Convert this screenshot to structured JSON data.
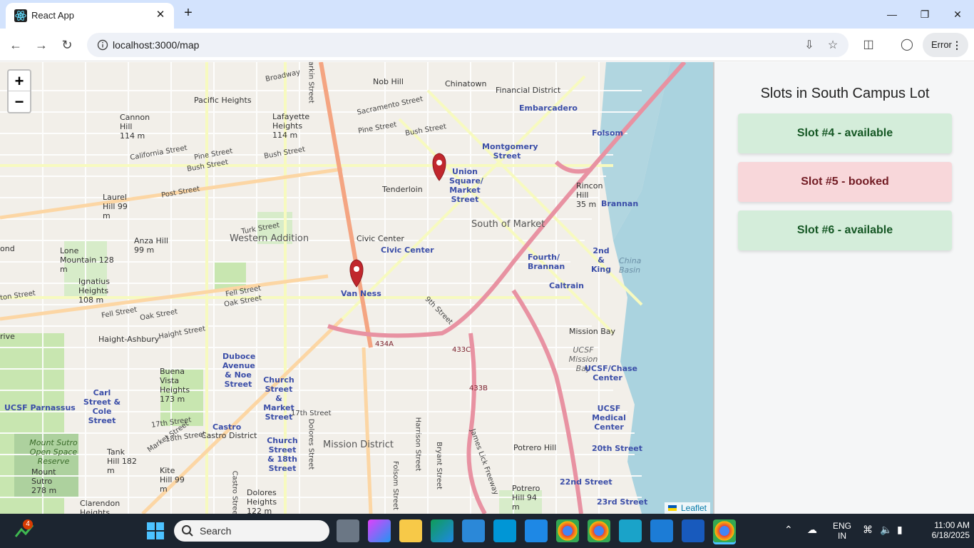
{
  "browser": {
    "tab_title": "React App",
    "tab_close": "✕",
    "new_tab": "+",
    "url": "localhost:3000/map",
    "profile_button": "Error"
  },
  "map": {
    "zoom_in": "+",
    "zoom_out": "−",
    "attribution": "Leaflet",
    "labels": {
      "nob_hill": "Nob Hill",
      "chinatown": "Chinatown",
      "financial_district": "Financial District",
      "pacific_heights": "Pacific Heights",
      "embarcadero": "Embarcadero",
      "folsom": "Folsom",
      "montgomery": "Montgomery Street",
      "union_square": "Union Square/ Market Street",
      "tenderloin": "Tenderloin",
      "south_of_market": "South of Market",
      "western_addition": "Western Addition",
      "civic_center": "Civic Center",
      "civic_center_station": "Civic Center",
      "van_ness": "Van Ness",
      "brannan": "Brannan",
      "fourth_brannan": "Fourth/ Brannan",
      "second_king": "2nd & King",
      "caltrain": "Caltrain",
      "mission_bay": "Mission Bay",
      "ucsf_mission_bay": "UCSF Mission Bay",
      "ucsf_chase": "UCSF/Chase Center",
      "haight_ashbury": "Haight-Ashbury",
      "duboce": "Duboce Avenue & Noe Street",
      "church_market": "Church Street & Market Street",
      "carl_cole": "Carl Street & Cole Street",
      "ucsf_parnassus": "UCSF Parnassus",
      "castro": "Castro",
      "castro_district": "Castro District",
      "church_18th": "Church Street & 18th Street",
      "mission_district": "Mission District",
      "potrero_hill": "Potrero Hill",
      "ucsf_medical": "UCSF Medical Center",
      "twentieth": "20th Street",
      "twentysecond": "22nd Street",
      "twentythird": "23rd Street",
      "lone_mountain": "Lone Mountain 128 m",
      "anza_hill": "Anza Hill 99 m",
      "laurel_hill": "Laurel Hill 99 m",
      "cannon_hill": "Cannon Hill 114 m",
      "lafayette_heights": "Lafayette Heights 114 m",
      "ignatius": "Ignatius Heights 108 m",
      "buena_vista": "Buena Vista Heights 173 m",
      "tank_hill": "Tank Hill 182 m",
      "kite_hill": "Kite Hill 99 m",
      "mount_sutro": "Mount Sutro 278 m",
      "mount_sutro_forest": "Mount Sutro Open Space Reserve",
      "clarendon": "Clarendon Heights",
      "dolores_heights": "Dolores Heights 122 m",
      "rincon_hill": "Rincon Hill 35 m",
      "china_basin": "China Basin",
      "potrero_94": "Potrero Hill 94 m",
      "broadway": "Broadway",
      "sacramento": "Sacramento Street",
      "pine": "Pine Street",
      "bush": "Bush Street",
      "california": "California Street",
      "post": "Post Street",
      "turk": "Turk Street",
      "fell": "Fell Street",
      "oak": "Oak Street",
      "haight": "Haight Street",
      "seventeenth": "17th Street",
      "eighteenth": "18th Street",
      "market": "Market Street",
      "ninth": "9th Street",
      "dolores": "Dolores Street",
      "harrison": "Harrison Street",
      "bryant": "Bryant Street",
      "folsom_st": "Folsom Street",
      "castro_st": "Castro Street",
      "james_lick": "James Lick Freeway",
      "larkin": "Larkin Street",
      "hwy_434a": "434A",
      "hwy_433c": "433C",
      "hwy_433b": "433B",
      "pond": "ond",
      "ton_street": "ton Street",
      "drive": "rive"
    }
  },
  "panel": {
    "title": "Slots in South Campus Lot",
    "slots": [
      {
        "label": "Slot #4 - available",
        "status": "available"
      },
      {
        "label": "Slot #5 - booked",
        "status": "booked"
      },
      {
        "label": "Slot #6 - available",
        "status": "available"
      }
    ]
  },
  "taskbar": {
    "search_placeholder": "Search",
    "badge_count": "4",
    "lang_top": "ENG",
    "lang_bottom": "IN",
    "time": "11:00 AM",
    "date": "6/18/2025"
  },
  "colors": {
    "accent": "#d83b01",
    "available_bg": "#d4edda",
    "booked_bg": "#f8d7da",
    "marker": "#c1272d",
    "water": "#aad3df"
  }
}
